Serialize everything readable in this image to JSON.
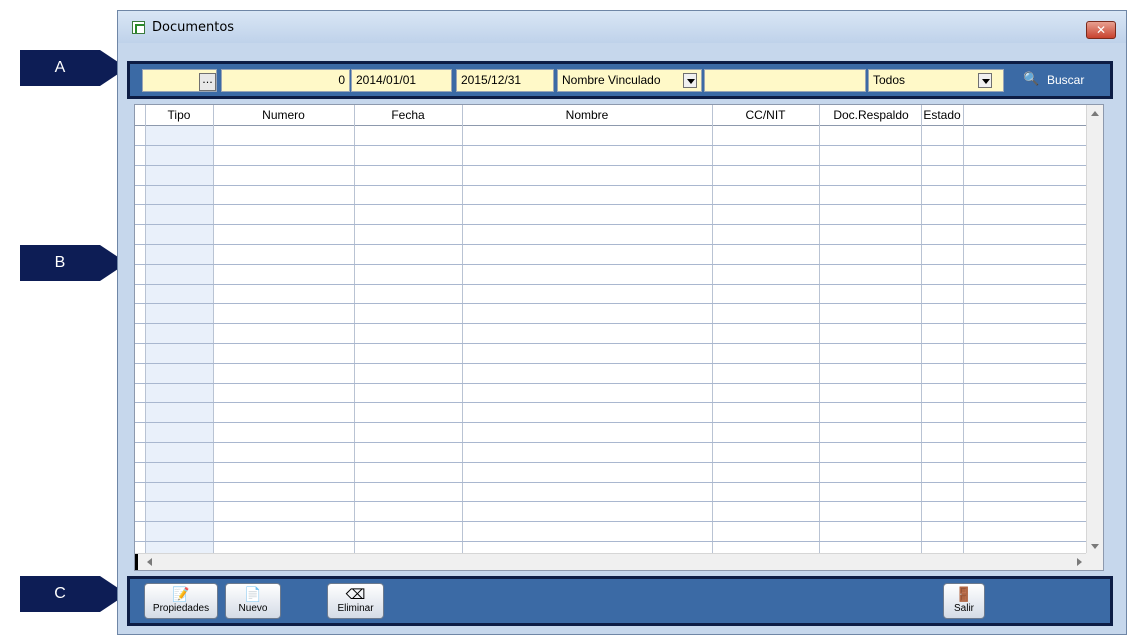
{
  "window": {
    "title": "Documentos",
    "close_glyph": "✕"
  },
  "callouts": [
    "A",
    "B",
    "C"
  ],
  "filters": {
    "code_value": "",
    "ellipsis_label": "...",
    "number_value": "0",
    "date_from": "2014/01/01",
    "date_to": "2015/12/31",
    "field_select": "Nombre Vinculado",
    "search_text": "",
    "status_select": "Todos",
    "search_button": "Buscar"
  },
  "grid": {
    "columns": [
      "Tipo",
      "Numero",
      "Fecha",
      "Nombre",
      "CC/NIT",
      "Doc.Respaldo",
      "Estado"
    ],
    "rows": []
  },
  "buttons": {
    "properties": "Propiedades",
    "new": "Nuevo",
    "delete": "Eliminar",
    "exit": "Salir"
  },
  "colors": {
    "panel_blue": "#3b6aa5",
    "panel_border": "#0d1d45",
    "input_yellow": "#fff9c8",
    "callout_navy": "#0d1d55"
  },
  "icons": {
    "app": "document-icon",
    "buscar": "search-icon",
    "properties": "edit-document-icon",
    "new": "new-document-icon",
    "delete": "eraser-icon",
    "exit": "exit-door-icon"
  }
}
